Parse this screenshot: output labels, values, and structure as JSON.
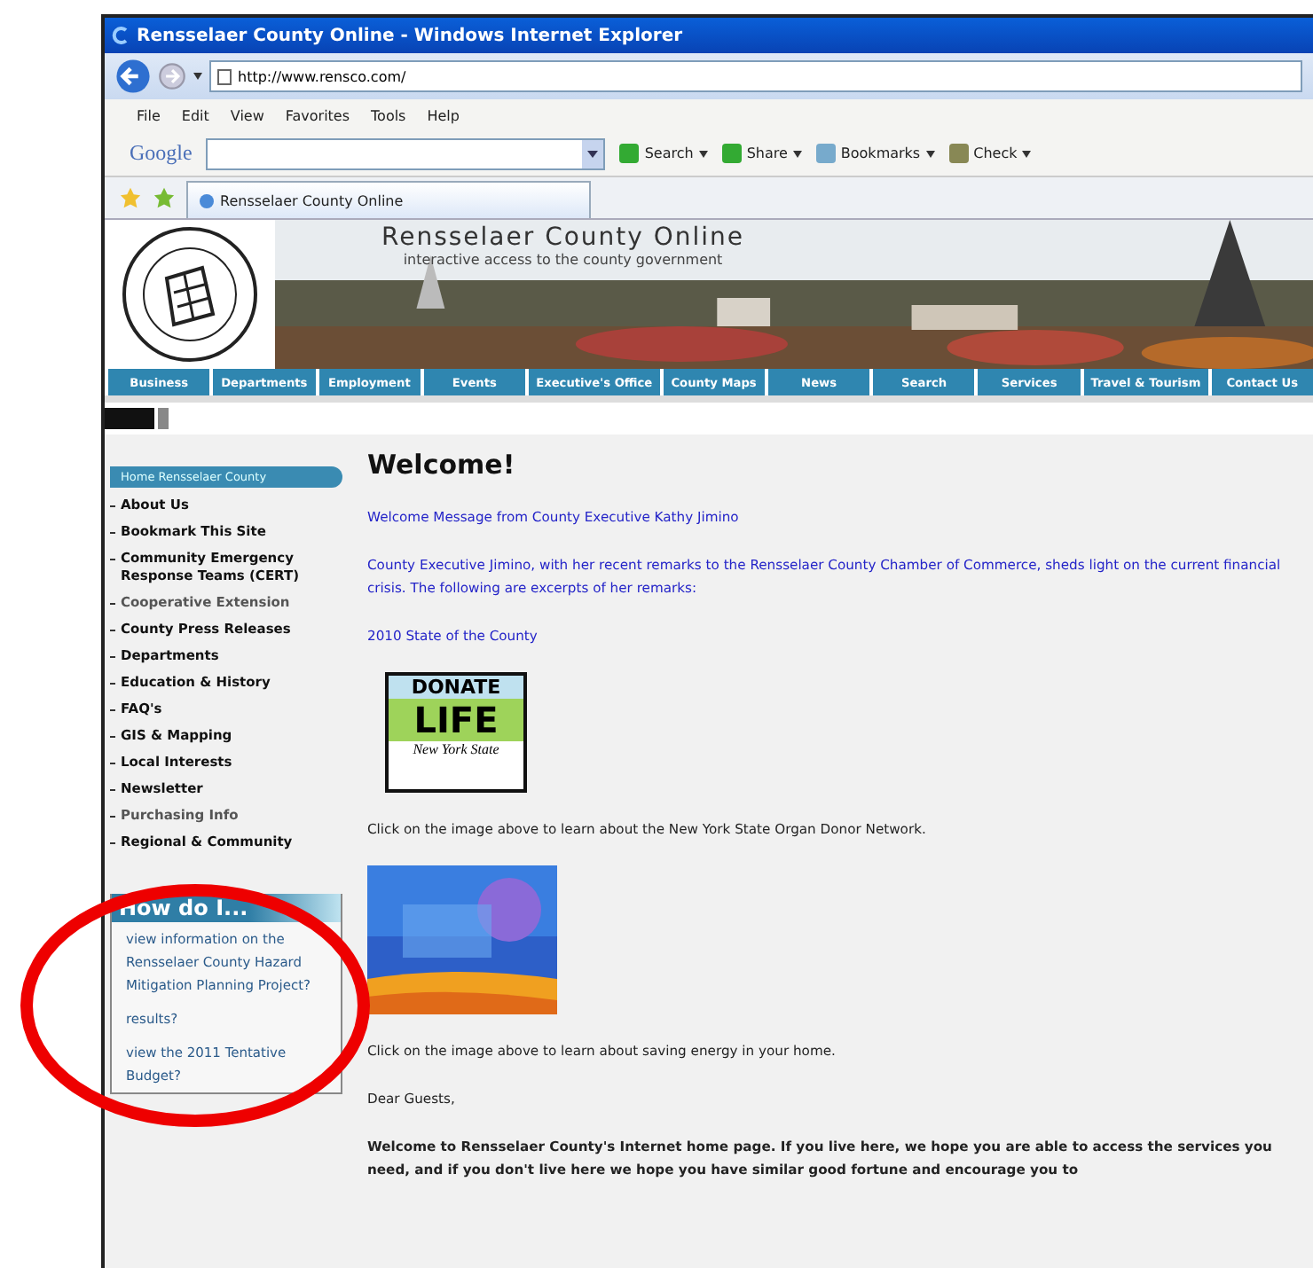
{
  "window": {
    "title": "Rensselaer County Online - Windows Internet Explorer"
  },
  "address": {
    "value": "http://www.rensco.com/"
  },
  "menu": [
    "File",
    "Edit",
    "View",
    "Favorites",
    "Tools",
    "Help"
  ],
  "google_toolbar": {
    "logo": "Google",
    "buttons": [
      "Search",
      "Share",
      "Bookmarks",
      "Check"
    ]
  },
  "tabs": [
    {
      "label": "Rensselaer County Online",
      "selected": true
    }
  ],
  "site": {
    "title": "Rensselaer County Online",
    "tagline": "interactive access to the county government"
  },
  "nav": [
    "Business",
    "Departments",
    "Employment",
    "Events",
    "Executive's Office",
    "County Maps",
    "News",
    "Search",
    "Services",
    "Travel & Tourism",
    "Contact Us"
  ],
  "sidebar": {
    "header": "Home Rensselaer County",
    "items": [
      {
        "label": "About Us",
        "visited": false
      },
      {
        "label": "Bookmark This Site",
        "visited": false
      },
      {
        "label": "Community Emergency Response Teams (CERT)",
        "visited": false
      },
      {
        "label": "Cooperative Extension",
        "visited": true
      },
      {
        "label": "County Press Releases",
        "visited": false
      },
      {
        "label": "Departments",
        "visited": false
      },
      {
        "label": "Education & History",
        "visited": false
      },
      {
        "label": "FAQ's",
        "visited": false
      },
      {
        "label": "GIS & Mapping",
        "visited": false
      },
      {
        "label": "Local Interests",
        "visited": false
      },
      {
        "label": "Newsletter",
        "visited": false
      },
      {
        "label": "Purchasing Info",
        "visited": true
      },
      {
        "label": "Regional & Community",
        "visited": false
      }
    ]
  },
  "how_do_i": {
    "title": "How do I...",
    "items": [
      "view information on the Rensselaer County Hazard Mitigation Planning Project?",
      "results?",
      "view the 2011 Tentative Budget?"
    ]
  },
  "main": {
    "heading": "Welcome!",
    "blocks": [
      {
        "kind": "link",
        "text": "Welcome Message from County Executive Kathy Jimino"
      },
      {
        "kind": "link",
        "text": "County Executive Jimino, with her recent remarks to the Rensselaer County Chamber of Commerce, sheds light on the current financial crisis. The following are excerpts of her remarks:"
      },
      {
        "kind": "link",
        "text": "2010 State of the County"
      },
      {
        "kind": "donate-logo",
        "top": "DONATE",
        "bottom": "LIFE",
        "script": "New York State"
      },
      {
        "kind": "text",
        "text": "Click on the image above to learn about the New York State Organ Donor Network."
      },
      {
        "kind": "picture"
      },
      {
        "kind": "text",
        "text": "Click on the image above to learn about saving energy in your home."
      },
      {
        "kind": "text",
        "text": "Dear Guests,"
      },
      {
        "kind": "bold",
        "text": "Welcome to Rensselaer County's Internet home page. If you live here, we hope you are able to access the services you need, and if you don't live here we hope you have similar good fortune and encourage you to"
      }
    ]
  }
}
